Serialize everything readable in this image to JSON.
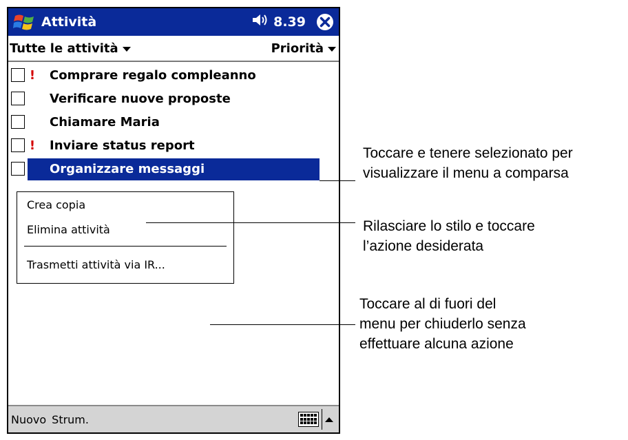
{
  "titlebar": {
    "app_title": "Attività",
    "clock": "8.39",
    "start_icon": "windows-flag-icon",
    "volume_icon": "speaker-icon",
    "close_icon": "close-circle-icon"
  },
  "filterbar": {
    "category_filter": "Tutte le attività",
    "sort_by": "Priorità"
  },
  "tasks": [
    {
      "label": "Comprare regalo compleanno",
      "priority": "!"
    },
    {
      "label": "Verificare nuove proposte",
      "priority": ""
    },
    {
      "label": "Chiamare Maria",
      "priority": ""
    },
    {
      "label": "Inviare status report",
      "priority": "!"
    },
    {
      "label": "Organizzare messaggi",
      "priority": ""
    }
  ],
  "context_menu": {
    "items": [
      "Crea copia",
      "Elimina attività",
      "Trasmetti attività via IR..."
    ]
  },
  "menubar": {
    "new": "Nuovo",
    "tools": "Strum."
  },
  "callouts": {
    "tap_hold": [
      "Toccare e tenere selezionato per",
      "visualizzare il menu a comparsa"
    ],
    "release": [
      "Rilasciare lo stilo e toccare",
      "l’azione desiderata"
    ],
    "tap_outside": [
      "Toccare al di fuori del",
      "menu per chiuderlo senza",
      "effettuare alcuna azione"
    ]
  },
  "colors": {
    "titlebar_bg": "#0a2a99",
    "selection_bg": "#0a2a99",
    "priority_mark": "#d40000"
  }
}
